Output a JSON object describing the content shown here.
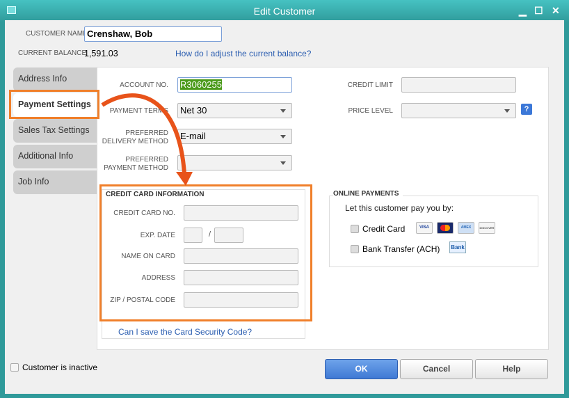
{
  "window": {
    "title": "Edit Customer",
    "minimize": "▁",
    "maximize": "☐",
    "close": "✕"
  },
  "customer_name": {
    "label": "CUSTOMER NAME",
    "value": "Crenshaw, Bob"
  },
  "balance": {
    "label": "CURRENT BALANCE",
    "value": "1,591.03",
    "help_link": "How do I adjust the current balance?"
  },
  "tabs": [
    {
      "label": "Address Info"
    },
    {
      "label": "Payment Settings"
    },
    {
      "label": "Sales Tax Settings"
    },
    {
      "label": "Additional Info"
    },
    {
      "label": "Job Info"
    }
  ],
  "payment": {
    "account_label": "ACCOUNT NO.",
    "account_value": "R3060255",
    "terms_label": "PAYMENT TERMS",
    "terms_value": "Net 30",
    "delivery_label": "PREFERRED DELIVERY METHOD",
    "delivery_value": "E-mail",
    "method_label": "PREFERRED PAYMENT METHOD",
    "method_value": "",
    "credit_limit_label": "CREDIT LIMIT",
    "price_level_label": "PRICE LEVEL",
    "help_icon": "?"
  },
  "credit_card": {
    "title": "CREDIT CARD INFORMATION",
    "number_label": "CREDIT CARD NO.",
    "exp_label": "EXP. DATE",
    "exp_sep": "/",
    "name_label": "NAME ON CARD",
    "address_label": "ADDRESS",
    "zip_label": "ZIP / POSTAL CODE",
    "security_link": "Can I save the Card Security Code?"
  },
  "online": {
    "title": "ONLINE PAYMENTS",
    "prompt": "Let this customer pay you by:",
    "credit_card": "Credit Card",
    "bank": "Bank Transfer (ACH)",
    "cards": [
      "VISA",
      "MC",
      "AMEX",
      "DISCOVER"
    ],
    "bank_badge": "Bank"
  },
  "footer": {
    "inactive": "Customer is inactive",
    "ok": "OK",
    "cancel": "Cancel",
    "help": "Help"
  },
  "colors": {
    "highlight": "#f07f2a",
    "accent": "#4a86d8"
  }
}
